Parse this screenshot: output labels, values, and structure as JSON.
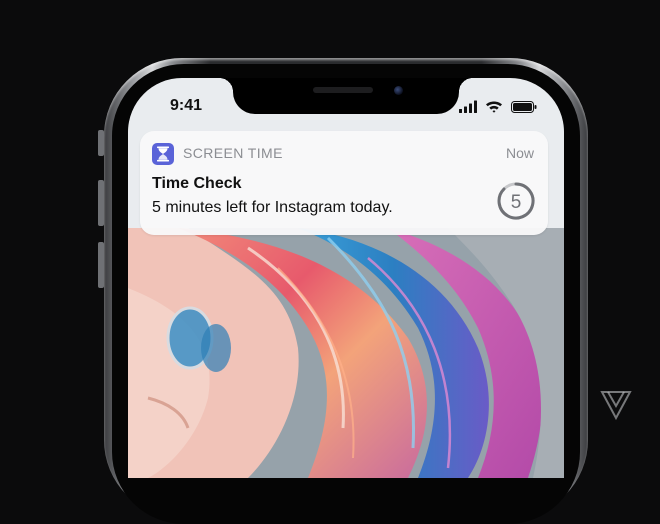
{
  "status_bar": {
    "time": "9:41",
    "icons": [
      "signal-icon",
      "wifi-icon",
      "battery-icon"
    ]
  },
  "notification": {
    "app_name": "SCREEN TIME",
    "time": "Now",
    "title": "Time Check",
    "message": "5 minutes left for Instagram today.",
    "timer_value": "5",
    "app_icon": "hourglass-icon",
    "accent_color": "#5a63d8"
  },
  "watermark_icon": "verge-logo-icon"
}
